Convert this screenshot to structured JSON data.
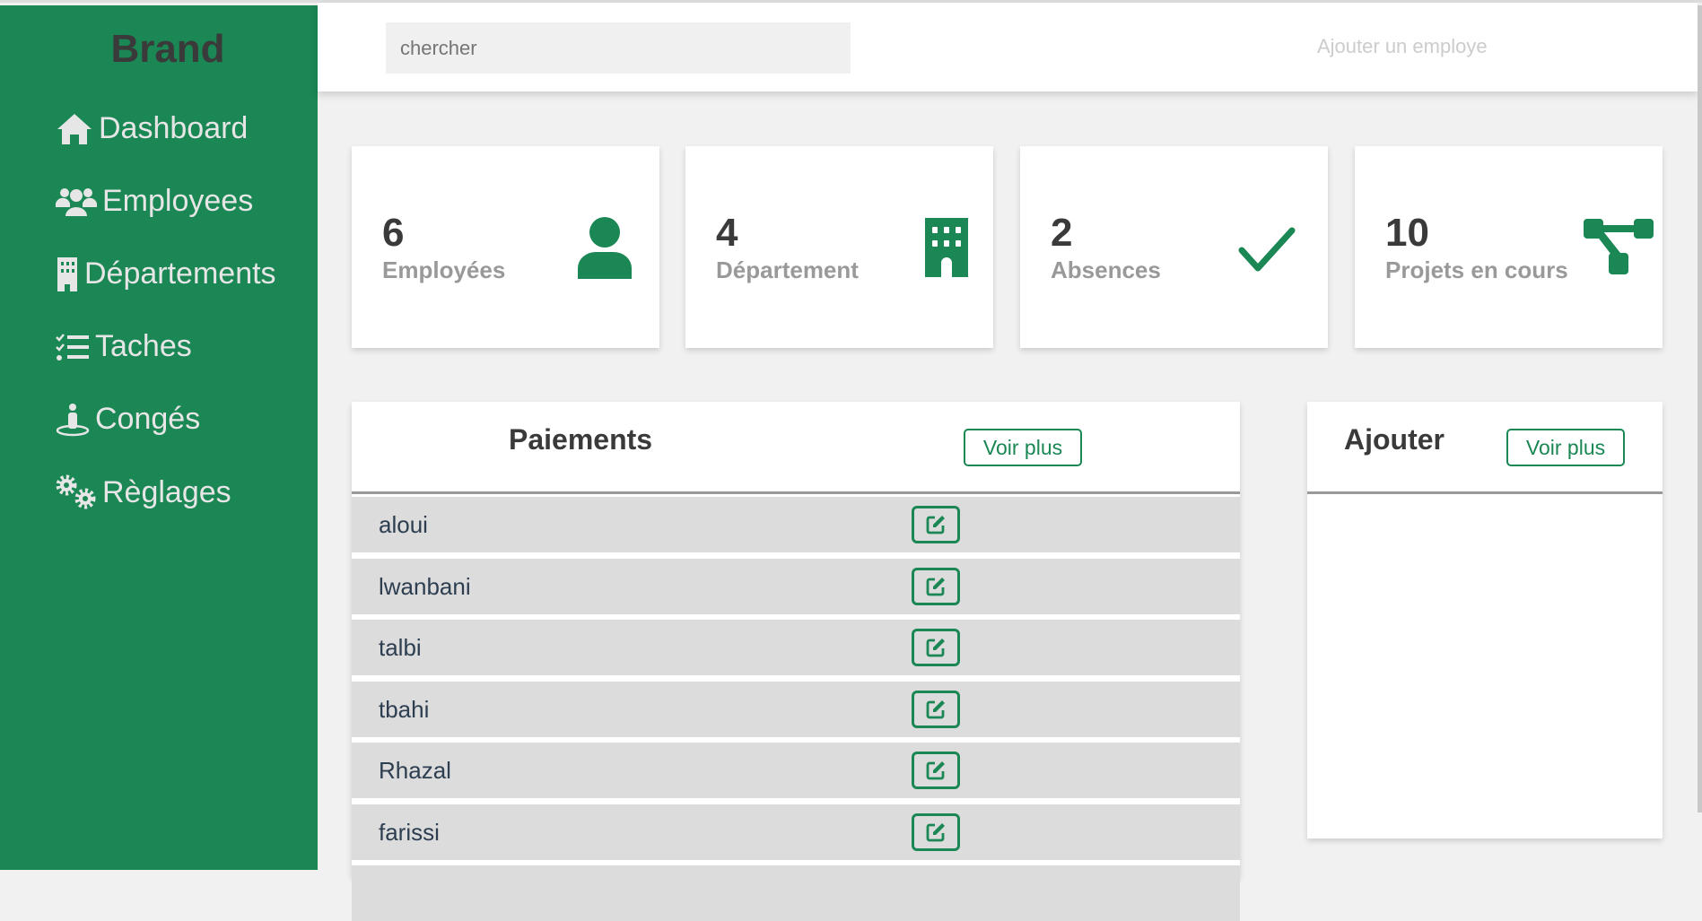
{
  "sidebar": {
    "brand": "Brand",
    "items": [
      {
        "label": "Dashboard",
        "icon": "home-icon"
      },
      {
        "label": "Employees",
        "icon": "users-icon"
      },
      {
        "label": "Départements",
        "icon": "building-icon"
      },
      {
        "label": "Taches",
        "icon": "tasks-icon"
      },
      {
        "label": "Congés",
        "icon": "person-pin-icon"
      },
      {
        "label": "Règlages",
        "icon": "gears-icon"
      }
    ]
  },
  "header": {
    "search_placeholder": "chercher",
    "add_employee": "Ajouter un employe"
  },
  "stats": [
    {
      "value": "6",
      "label": "Employées",
      "icon": "user-icon"
    },
    {
      "value": "4",
      "label": "Département",
      "icon": "building-icon"
    },
    {
      "value": "2",
      "label": "Absences",
      "icon": "check-icon"
    },
    {
      "value": "10",
      "label": "Projets en cours",
      "icon": "project-diagram-icon"
    }
  ],
  "payments": {
    "title": "Paiements",
    "more": "Voir plus",
    "rows": [
      "aloui",
      "lwanbani",
      "talbi",
      "tbahi",
      "Rhazal",
      "farissi"
    ]
  },
  "add_panel": {
    "title": "Ajouter",
    "more": "Voir plus"
  },
  "colors": {
    "accent": "#1a8754"
  }
}
